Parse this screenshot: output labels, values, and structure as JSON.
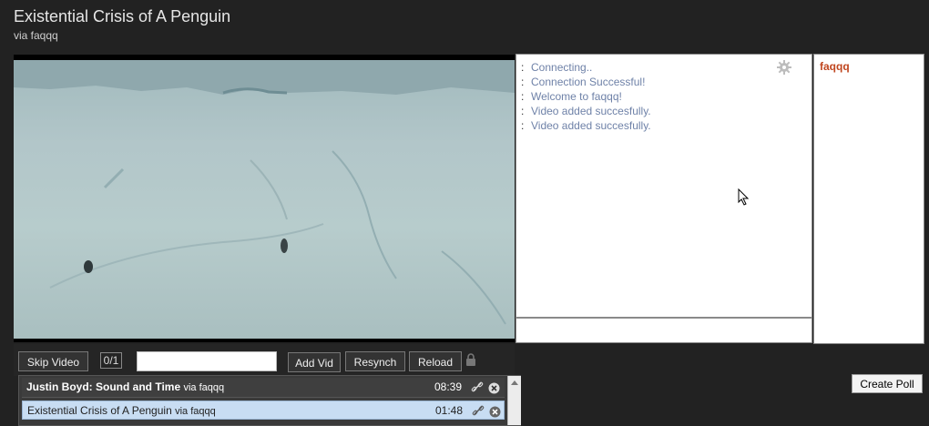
{
  "header": {
    "title": "Existential Crisis of A Penguin",
    "subtitle": "via faqqq"
  },
  "chat": {
    "separator": ":",
    "messages": [
      "Connecting..",
      "Connection Successful!",
      "Welcome to faqqq!",
      "Video added succesfully.",
      "Video added succesfully."
    ],
    "input_value": ""
  },
  "users": [
    "faqqq"
  ],
  "controls": {
    "skip_label": "Skip Video",
    "counter": "0/1",
    "url_value": "",
    "add_label": "Add Vid",
    "resynch_label": "Resynch",
    "reload_label": "Reload"
  },
  "playlist": [
    {
      "title": "Justin Boyd: Sound and Time",
      "via": "via faqqq",
      "duration": "08:39",
      "state": "active"
    },
    {
      "title": "Existential Crisis of A Penguin",
      "via": "via faqqq",
      "duration": "01:48",
      "state": "selected"
    }
  ],
  "poll": {
    "label": "Create Poll"
  },
  "icons": {
    "settings": "gear-icon",
    "lock": "lock-icon",
    "link": "link-icon",
    "remove": "close-circle-icon"
  },
  "colors": {
    "background": "#222222",
    "chat_text": "#6f82a8",
    "username": "#c0461f",
    "selected_row": "#c8ddf3"
  }
}
